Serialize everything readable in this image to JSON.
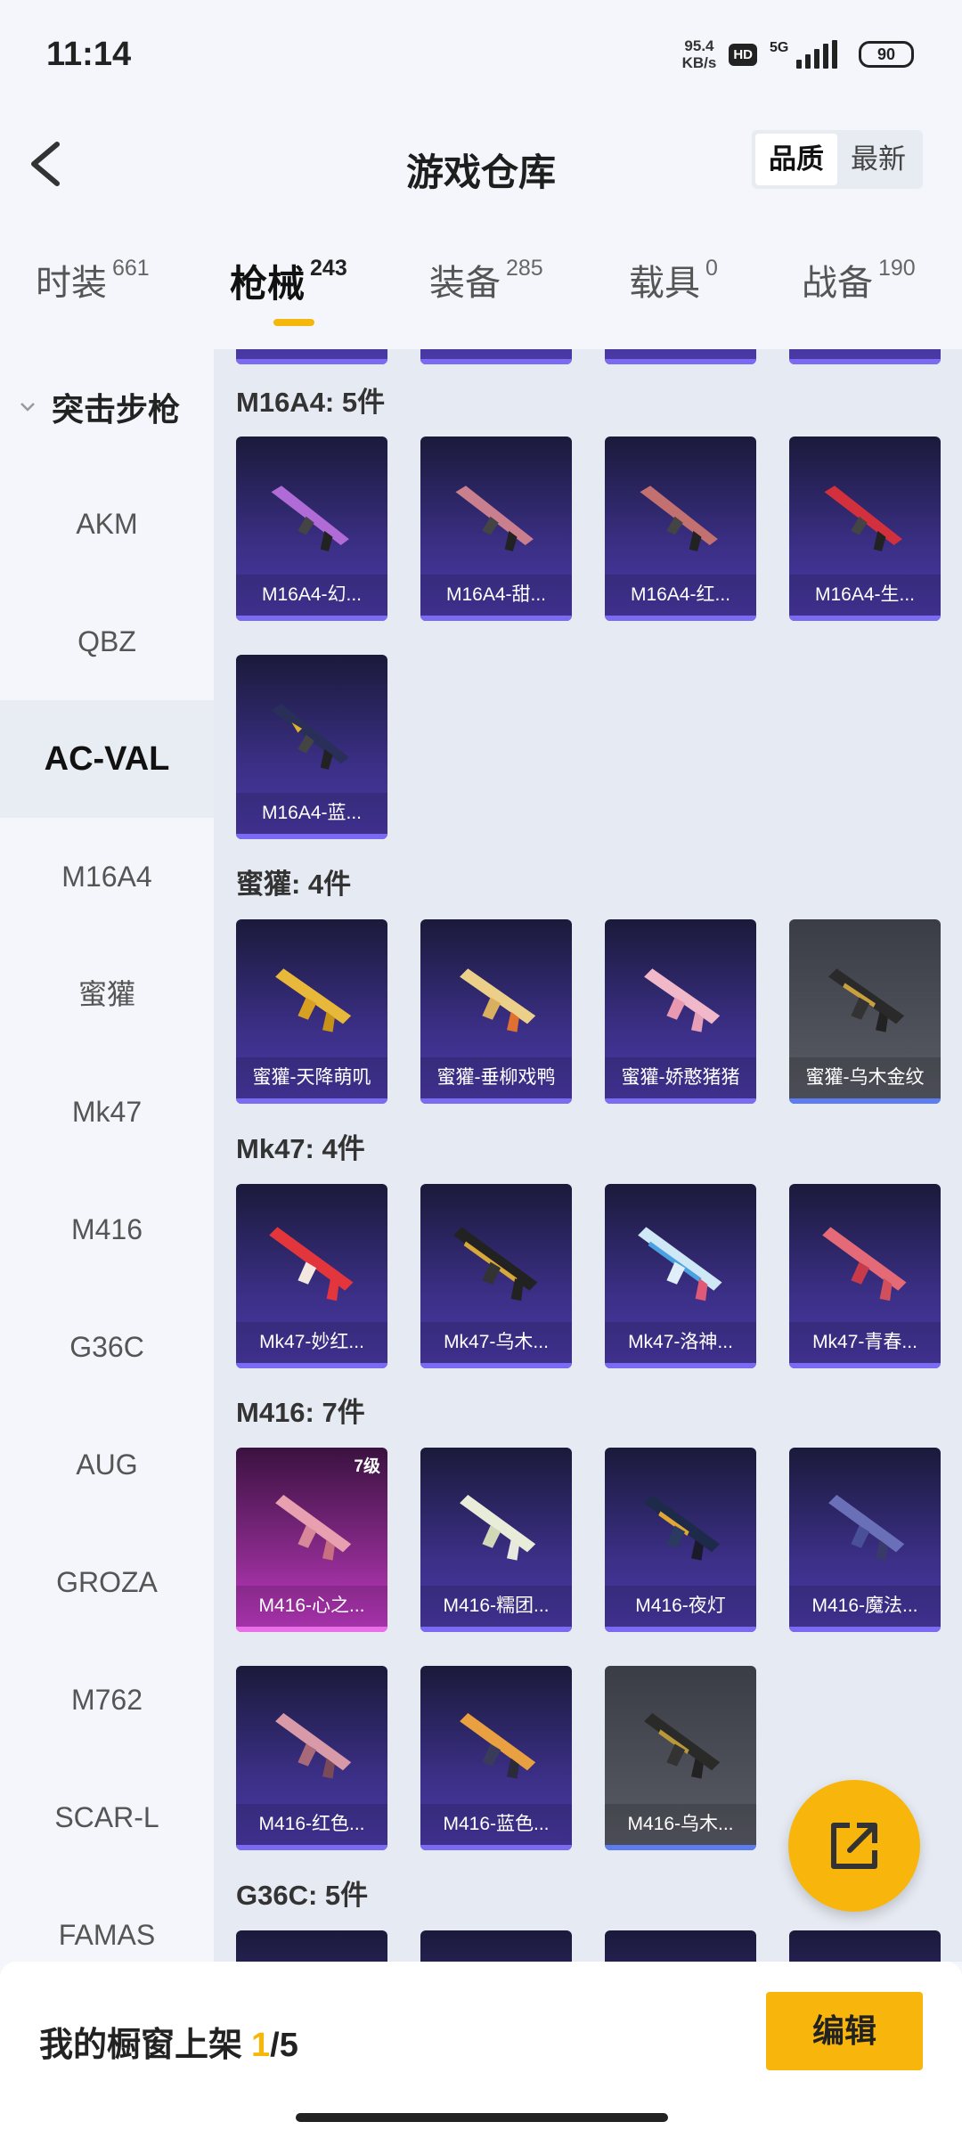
{
  "status_bar": {
    "time": "11:14",
    "speed": "95.4",
    "speed_unit": "KB/s",
    "hd": "HD",
    "network": "5G",
    "battery": "90"
  },
  "header": {
    "title": "游戏仓库",
    "sort_quality": "品质",
    "sort_latest": "最新"
  },
  "tabs": [
    {
      "label": "时装",
      "count": "661"
    },
    {
      "label": "枪械",
      "count": "243"
    },
    {
      "label": "装备",
      "count": "285"
    },
    {
      "label": "载具",
      "count": "0"
    },
    {
      "label": "战备",
      "count": "190"
    }
  ],
  "sidebar": {
    "category": "突击步枪",
    "items": [
      "AKM",
      "QBZ",
      "AC-VAL",
      "M16A4",
      "蜜獾",
      "Mk47",
      "M416",
      "G36C",
      "AUG",
      "GROZA",
      "M762",
      "SCAR-L",
      "FAMAS"
    ],
    "selected": "AC-VAL"
  },
  "sections": [
    {
      "title": "M16A4: 5件",
      "items": [
        "M16A4-幻...",
        "M16A4-甜...",
        "M16A4-红...",
        "M16A4-生...",
        "M16A4-蓝..."
      ]
    },
    {
      "title": "蜜獾: 4件",
      "items": [
        "蜜獾-天降萌叽",
        "蜜獾-垂柳戏鸭",
        "蜜獾-娇憨猪猪",
        "蜜獾-乌木金纹"
      ]
    },
    {
      "title": "Mk47: 4件",
      "items": [
        "Mk47-妙红...",
        "Mk47-乌木...",
        "Mk47-洛神...",
        "Mk47-青春..."
      ]
    },
    {
      "title": "M416: 7件",
      "items": [
        "M416-心之...",
        "M416-糯团...",
        "M416-夜灯",
        "M416-魔法...",
        "M416-红色...",
        "M416-蓝色...",
        "M416-乌木..."
      ]
    },
    {
      "title": "G36C: 5件",
      "items": []
    }
  ],
  "badge_level": "7级",
  "bottom": {
    "shelf_label": "我的橱窗上架",
    "shelf_current": "1",
    "shelf_total": "/5",
    "edit_label": "编辑"
  }
}
